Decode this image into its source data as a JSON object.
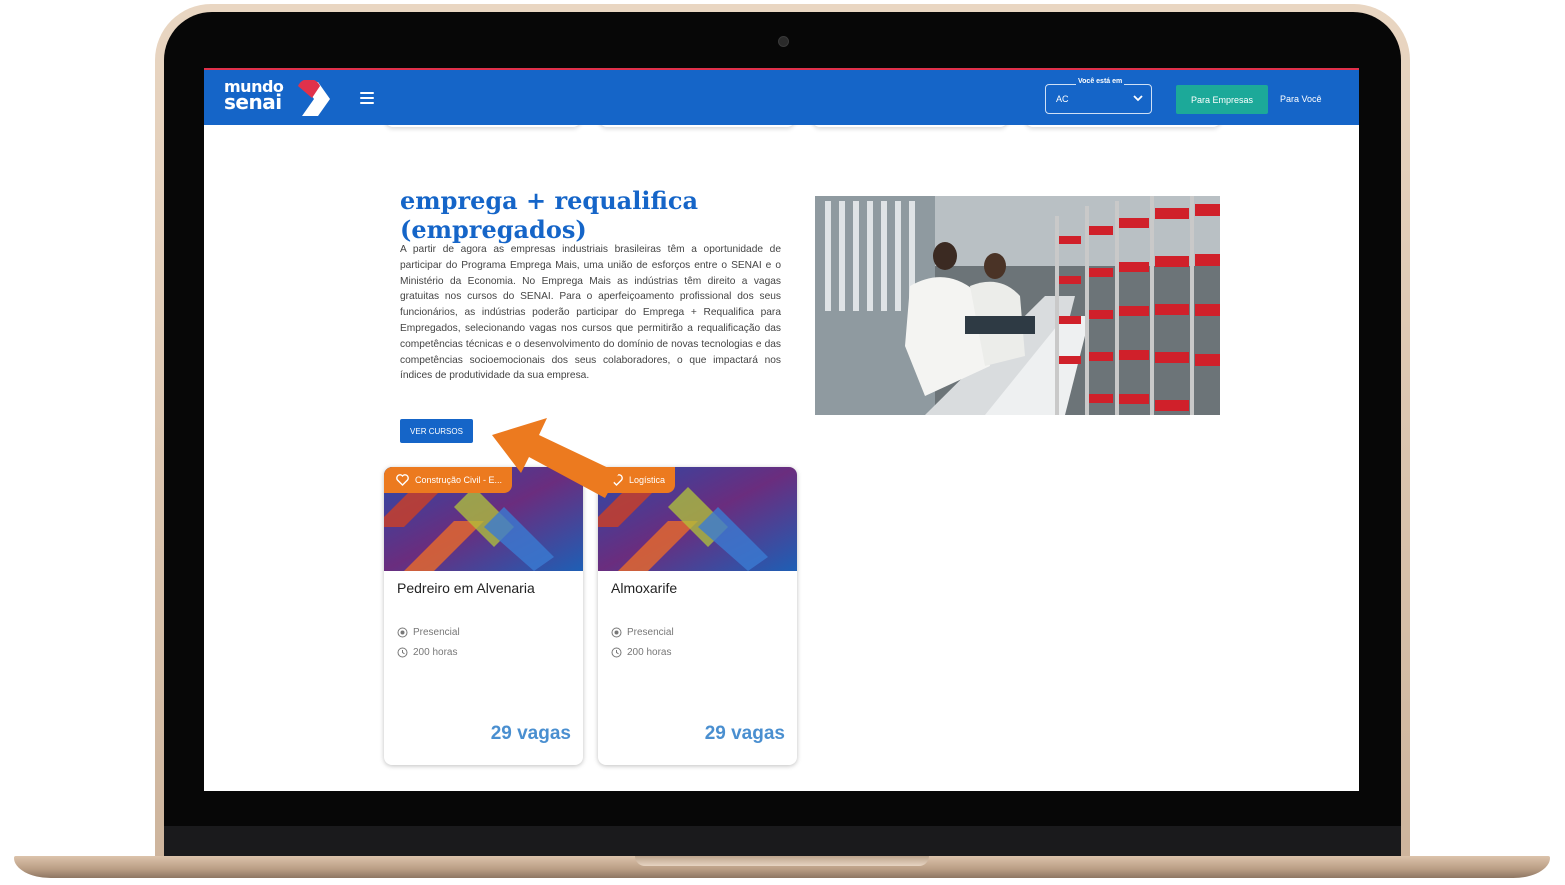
{
  "header": {
    "logo_line1": "mundo",
    "logo_line2": "senai",
    "location_label": "Você está em",
    "location_value": "AC",
    "btn_empresas": "Para Empresas",
    "link_voce": "Para Você"
  },
  "section": {
    "title": "emprega + requalifica (empregados)",
    "description": "A partir de agora as empresas industriais brasileiras têm a oportunidade de participar do Programa Emprega Mais, uma união de esforços entre o SENAI e o Ministério da Economia. No Emprega Mais as indústrias têm direito a vagas gratuitas nos cursos do SENAI. Para o aperfeiçoamento profissional dos seus funcionários, as indústrias poderão participar do Emprega + Requalifica para Empregados, selecionando vagas nos cursos que permitirão a requalificação das competências técnicas e o desenvolvimento do domínio de novas tecnologias e das competências socioemocionais dos seus colaboradores, o que impactará nos índices de produtividade da sua empresa.",
    "button": "VER CURSOS"
  },
  "cards": [
    {
      "tag": "Construção Civil - E...",
      "title": "Pedreiro em Alvenaria",
      "modality": "Presencial",
      "hours": "200 horas",
      "vagas": "29 vagas"
    },
    {
      "tag": "Logística",
      "title": "Almoxarife",
      "modality": "Presencial",
      "hours": "200 horas",
      "vagas": "29 vagas"
    }
  ],
  "colors": {
    "primary": "#1565c8",
    "accent": "#ec7a1f",
    "teal": "#1ca999",
    "vagas": "#4a8fd0"
  }
}
